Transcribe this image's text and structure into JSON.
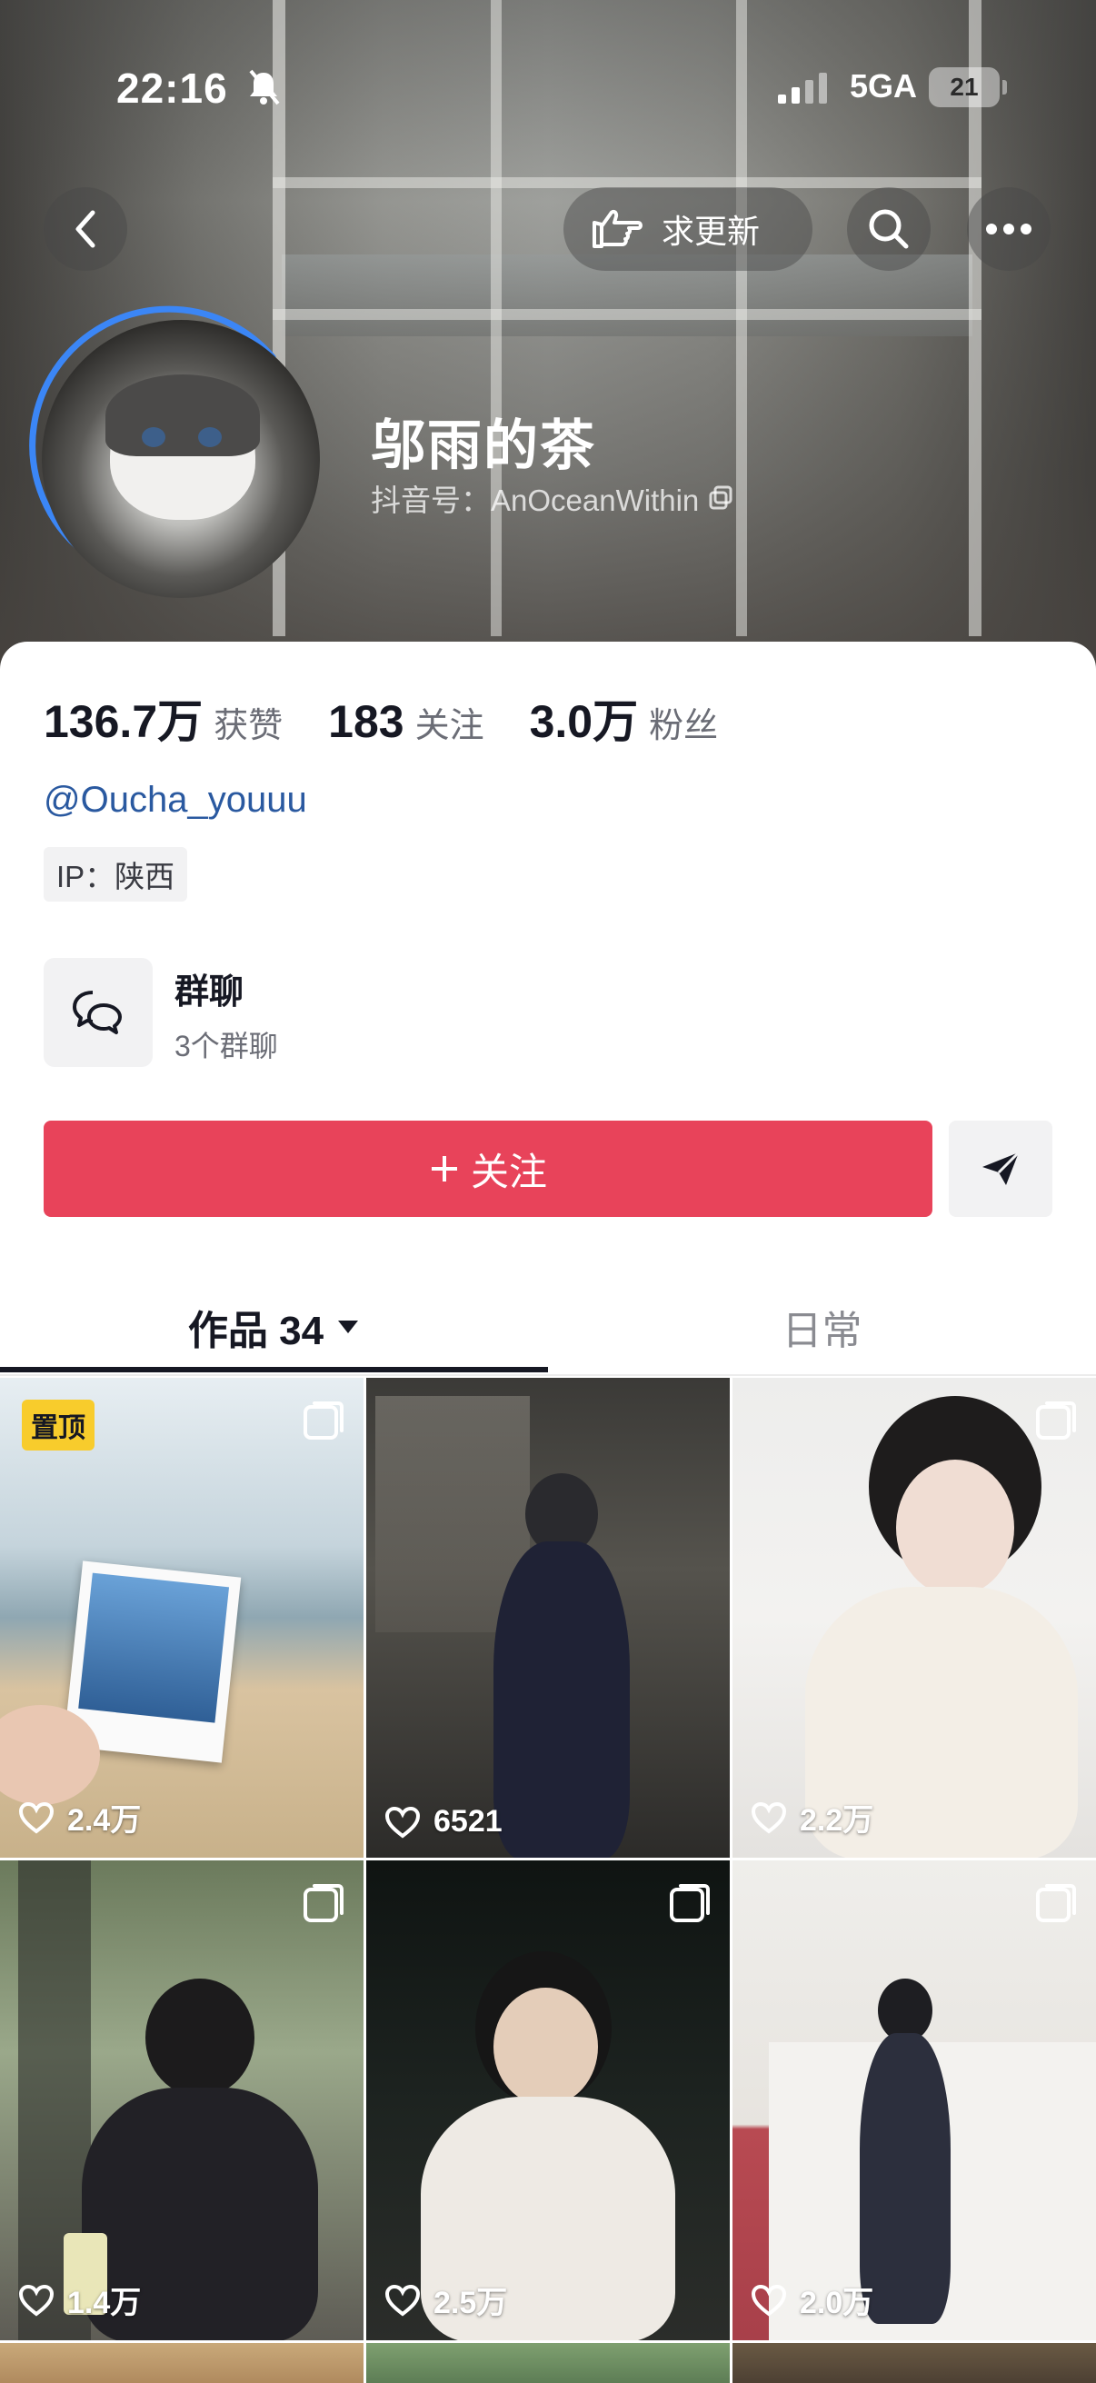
{
  "status_bar": {
    "time": "22:16",
    "network": "5GA",
    "battery": "21"
  },
  "header": {
    "request_update_label": "求更新",
    "name": "邬雨的茶",
    "douyin_id": "抖音号：AnOceanWithin"
  },
  "stats": [
    {
      "value": "136.7万",
      "label": "获赞"
    },
    {
      "value": "183",
      "label": "关注"
    },
    {
      "value": "3.0万",
      "label": "粉丝"
    }
  ],
  "handle": "@Oucha_youuu",
  "ip": "IP：陕西",
  "group_chat": {
    "title": "群聊",
    "subtitle": "3个群聊"
  },
  "follow_button": "关注",
  "tabs": {
    "works": "作品 34",
    "daily": "日常"
  },
  "pinned_label": "置顶",
  "posts": [
    {
      "likes": "2.4万",
      "pinned": true
    },
    {
      "likes": "6521"
    },
    {
      "likes": "2.2万"
    },
    {
      "likes": "1.4万"
    },
    {
      "likes": "2.5万"
    },
    {
      "likes": "2.0万"
    }
  ],
  "colors": {
    "follow": "#e8435a",
    "pin_badge": "#f8cc2c",
    "handle": "#2a59a0",
    "story_ring": "#3b86f6"
  }
}
